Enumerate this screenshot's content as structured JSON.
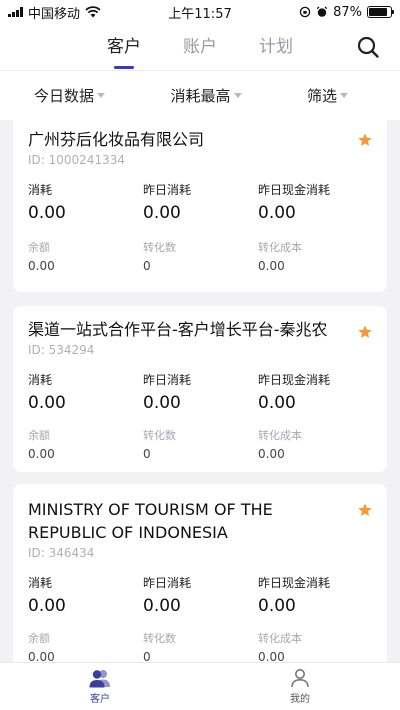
{
  "status": {
    "carrier": "中国移动",
    "time": "上午11:57",
    "battery": "87%",
    "battery_level": 0.87
  },
  "nav": {
    "tabs": [
      {
        "label": "客户"
      },
      {
        "label": "账户"
      },
      {
        "label": "计划"
      }
    ]
  },
  "filters": [
    {
      "label": "今日数据"
    },
    {
      "label": "消耗最高"
    },
    {
      "label": "筛选"
    }
  ],
  "metric_labels": {
    "spend": "消耗",
    "yesterday_spend": "昨日消耗",
    "yesterday_cash": "昨日现金消耗",
    "balance": "余额",
    "conversions": "转化数",
    "conv_cost": "转化成本"
  },
  "cards": [
    {
      "name": "广州芬后化妆品有限公司",
      "id": "ID: 1000241334",
      "spend": "0.00",
      "yesterday_spend": "0.00",
      "yesterday_cash": "0.00",
      "balance": "0.00",
      "conversions": "0",
      "conv_cost": "0.00"
    },
    {
      "name": "渠道一站式合作平台-客户增长平台-秦兆农",
      "id": "ID: 534294",
      "spend": "0.00",
      "yesterday_spend": "0.00",
      "yesterday_cash": "0.00",
      "balance": "0.00",
      "conversions": "0",
      "conv_cost": "0.00"
    },
    {
      "name": "MINISTRY OF TOURISM OF THE REPUBLIC OF INDONESIA",
      "id": "ID: 346434",
      "spend": "0.00",
      "yesterday_spend": "0.00",
      "yesterday_cash": "0.00",
      "balance": "0.00",
      "conversions": "0",
      "conv_cost": "0.00"
    }
  ],
  "bottom_tabs": [
    {
      "label": "客户"
    },
    {
      "label": "我的"
    }
  ],
  "colors": {
    "accent": "#3c3f9e",
    "star": "#f29a3e",
    "background": "#f2f2f4"
  }
}
